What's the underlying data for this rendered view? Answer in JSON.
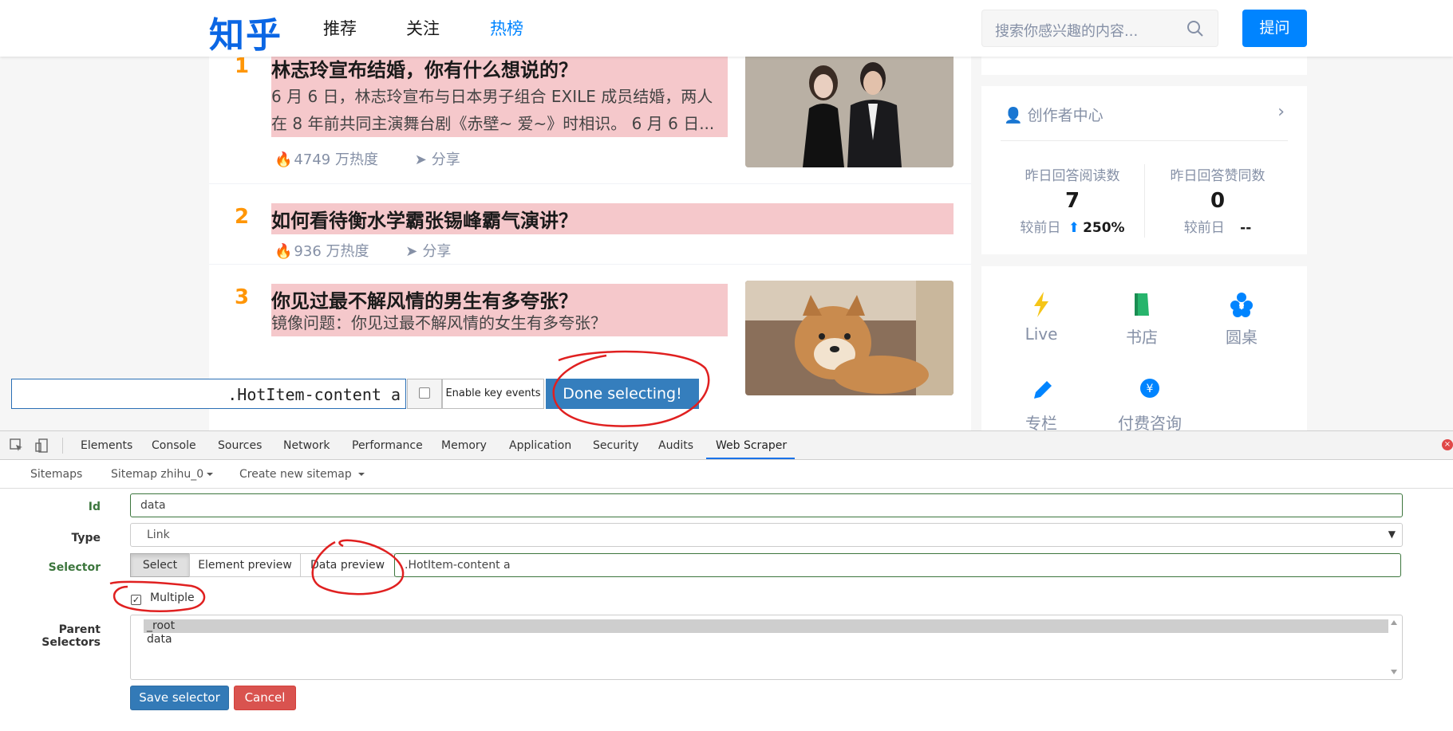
{
  "zhihu": {
    "logo": "知乎",
    "nav": [
      "推荐",
      "关注",
      "热榜"
    ],
    "search_placeholder": "搜索你感兴趣的内容...",
    "ask_button": "提问",
    "hot_items": [
      {
        "rank": "1",
        "title": "林志玲宣布结婚，你有什么想说的？",
        "excerpt_line1": "6 月 6 日，林志玲宣布与日本男子组合 EXILE 成员结婚，两人",
        "excerpt_line2": "在 8 年前共同主演舞台剧《赤壁~ 爱~》时相识。 6 月 6 日...",
        "heat": "4749 万热度",
        "share": "分享"
      },
      {
        "rank": "2",
        "title": "如何看待衡水学霸张锡峰霸气演讲？",
        "heat": "936 万热度",
        "share": "分享"
      },
      {
        "rank": "3",
        "title": "你见过最不解风情的男生有多夸张？",
        "excerpt_line1": "镜像问题：你见过最不解风情的女生有多夸张？"
      }
    ],
    "creator_center": {
      "title": "创作者中心",
      "stats": [
        {
          "label": "昨日回答阅读数",
          "value": "7",
          "compare_label": "较前日",
          "compare_value": "250%"
        },
        {
          "label": "昨日回答赞同数",
          "value": "0",
          "compare_label": "较前日",
          "compare_value": "--"
        }
      ]
    },
    "tools": [
      "Live",
      "书店",
      "圆桌",
      "专栏",
      "付费咨询"
    ]
  },
  "scraper_overlay": {
    "selector_text": ".HotItem-content a",
    "enable_key_events": "Enable key events",
    "done_button": "Done selecting!"
  },
  "devtools": {
    "tabs": [
      "Elements",
      "Console",
      "Sources",
      "Network",
      "Performance",
      "Memory",
      "Application",
      "Security",
      "Audits",
      "Web Scraper"
    ],
    "active_tab": "Web Scraper"
  },
  "web_scraper": {
    "nav": {
      "sitemaps": "Sitemaps",
      "sitemap": "Sitemap zhihu_0",
      "create": "Create new sitemap"
    },
    "form": {
      "id_label": "Id",
      "id_value": "data",
      "type_label": "Type",
      "type_value": "Link",
      "selector_label": "Selector",
      "select_button": "Select",
      "element_preview_button": "Element preview",
      "data_preview_button": "Data preview",
      "selector_value": ".HotItem-content a",
      "multiple_label": "Multiple",
      "multiple_checked": true,
      "parent_selectors_label": "Parent Selectors",
      "parent_selectors": [
        "_root",
        "data"
      ],
      "save_button": "Save selector",
      "cancel_button": "Cancel"
    }
  }
}
